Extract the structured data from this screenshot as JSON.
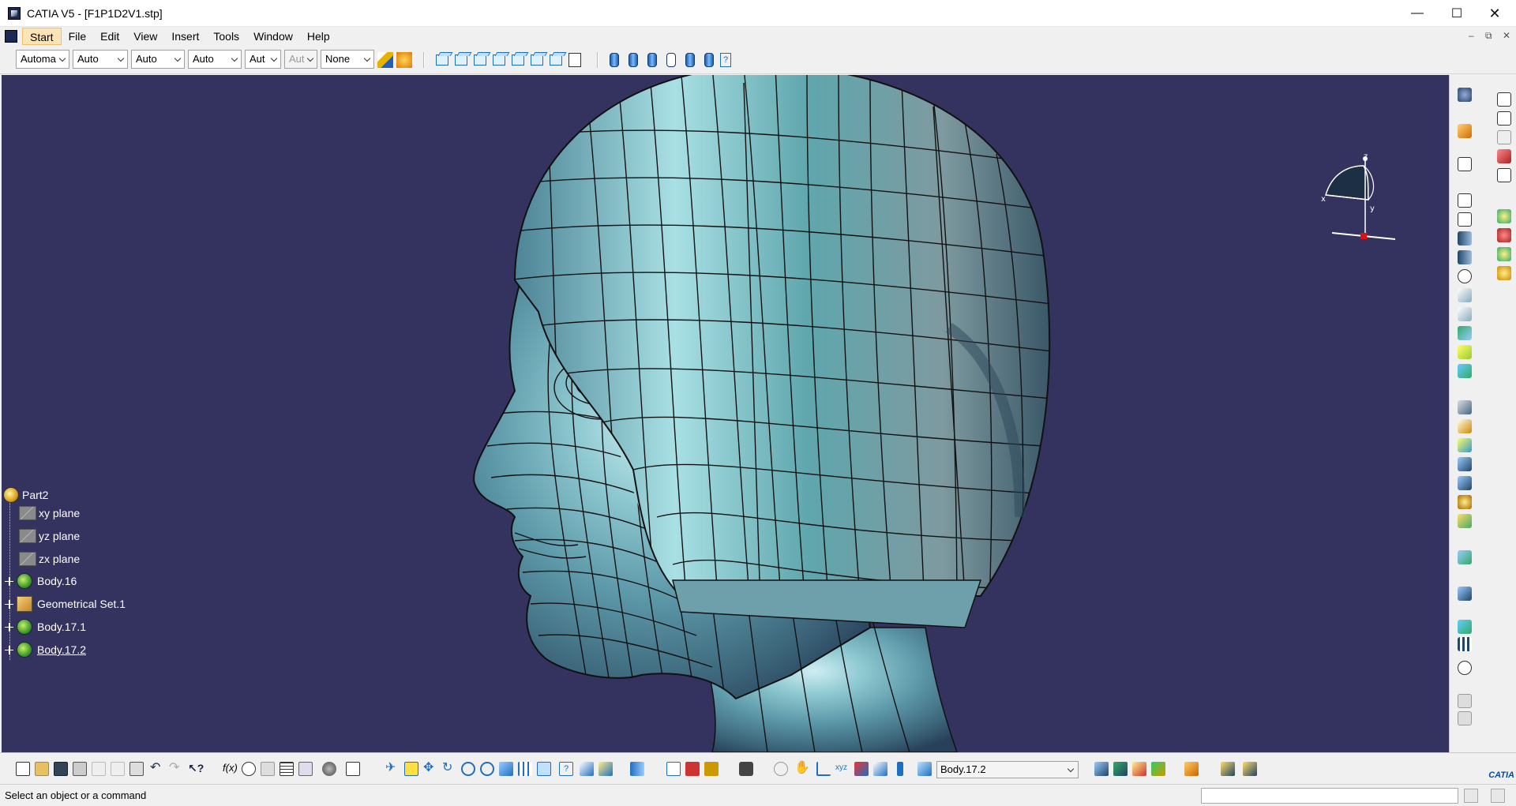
{
  "window": {
    "title": "CATIA V5 - [F1P1D2V1.stp]",
    "minimize": "—",
    "maximize": "☐",
    "close": "✕"
  },
  "menu": {
    "items": [
      "Start",
      "File",
      "Edit",
      "View",
      "Insert",
      "Tools",
      "Window",
      "Help"
    ],
    "active": "Start"
  },
  "properties_toolbar": {
    "color": "Automa",
    "transparency": "Auto",
    "line_thickness": "Auto",
    "linetype": "Auto",
    "point_symbol": "Aut",
    "rendering_style": "Aut",
    "layer": "None"
  },
  "spec_tree": {
    "root": "Part2",
    "nodes": [
      {
        "label": "xy plane",
        "icon": "plane-icon"
      },
      {
        "label": "yz plane",
        "icon": "plane-icon"
      },
      {
        "label": "zx plane",
        "icon": "plane-icon"
      },
      {
        "label": "Body.16",
        "icon": "body-icon"
      },
      {
        "label": "Geometrical Set.1",
        "icon": "geometrical-set-icon"
      },
      {
        "label": "Body.17.1",
        "icon": "body-icon"
      },
      {
        "label": "Body.17.2",
        "icon": "body-icon"
      }
    ]
  },
  "compass": {
    "x": "x",
    "y": "y",
    "z": "z"
  },
  "triad": {
    "x": "x",
    "y": "y",
    "z": "z"
  },
  "bottom_toolbar": {
    "current_body": "Body.17.2",
    "logo": "CATIA"
  },
  "status": {
    "message": "Select an object or a command"
  },
  "colors": {
    "viewport_bg": "#34325f",
    "model": "#5f9fab",
    "accent": "#fce4b6"
  }
}
